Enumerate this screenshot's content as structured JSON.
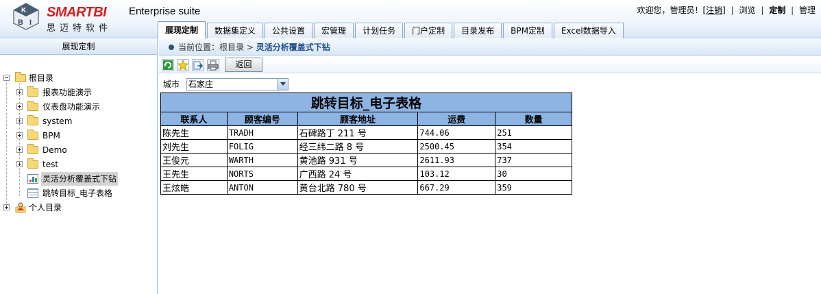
{
  "header": {
    "logo_text": "SMARTBI",
    "logo_cn": "思迈特软件",
    "suite": "Enterprise suite",
    "welcome": "欢迎您，管理员！[",
    "logout": "注销",
    "welcome_end": "]",
    "browse": "浏览",
    "customize": "定制",
    "manage": "管理"
  },
  "tabs": [
    {
      "label": "展现定制",
      "active": true
    },
    {
      "label": "数据集定义",
      "active": false
    },
    {
      "label": "公共设置",
      "active": false
    },
    {
      "label": "宏管理",
      "active": false
    },
    {
      "label": "计划任务",
      "active": false
    },
    {
      "label": "门户定制",
      "active": false
    },
    {
      "label": "目录发布",
      "active": false
    },
    {
      "label": "BPM定制",
      "active": false
    },
    {
      "label": "Excel数据导入",
      "active": false
    }
  ],
  "sidebar": {
    "title": "展现定制",
    "items": [
      {
        "label": "根目录"
      },
      {
        "label": "报表功能演示"
      },
      {
        "label": "仪表盘功能演示"
      },
      {
        "label": "system"
      },
      {
        "label": "BPM"
      },
      {
        "label": "Demo"
      },
      {
        "label": "test"
      },
      {
        "label": "灵活分析覆盖式下钻"
      },
      {
        "label": "跳转目标_电子表格"
      },
      {
        "label": "个人目录"
      }
    ]
  },
  "breadcrumb": {
    "prefix": "当前位置：",
    "root": "根目录",
    "sep": ">",
    "current": "灵活分析覆盖式下钻"
  },
  "toolbar": {
    "icons": [
      "refresh-icon",
      "favorite-star-icon",
      "export-icon",
      "print-icon"
    ],
    "back_label": "返回"
  },
  "filter": {
    "label": "城市",
    "value": "石家庄"
  },
  "report": {
    "title": "跳转目标_电子表格",
    "columns": [
      "联系人",
      "顾客编号",
      "顾客地址",
      "运费",
      "数量"
    ],
    "rows": [
      [
        "陈先生",
        "TRADH",
        "石碑路丁 211 号",
        "744.06",
        "251"
      ],
      [
        "刘先生",
        "FOLIG",
        "经三纬二路 8 号",
        "2500.45",
        "354"
      ],
      [
        "王俊元",
        "WARTH",
        "黄池路 931 号",
        "2611.93",
        "737"
      ],
      [
        "王先生",
        "NORTS",
        "广西路 24 号",
        "103.12",
        "30"
      ],
      [
        "王炫皓",
        "ANTON",
        "黄台北路 780 号",
        "667.29",
        "359"
      ]
    ]
  },
  "colors": {
    "header_blue": "#8db4e2",
    "brand_red": "#d41e1e",
    "crumb_blue": "#1f4f91"
  }
}
